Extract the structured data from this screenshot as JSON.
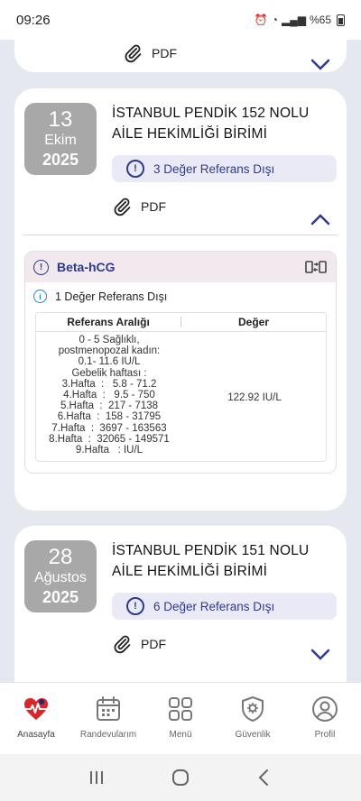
{
  "status_bar": {
    "time": "09:26",
    "battery": "%65"
  },
  "records": [
    {
      "pdf_label": "PDF"
    },
    {
      "date": {
        "day": "13",
        "month": "Ekim",
        "year": "2025"
      },
      "institution": "İSTANBUL PENDİK 152 NOLU AİLE HEKİMLİĞİ BİRİMİ",
      "out_of_range": "3 Değer Referans Dışı",
      "pdf_label": "PDF",
      "test": {
        "name": "Beta-hCG",
        "info": "1 Değer Referans Dışı",
        "columns": [
          "Referans Aralığı",
          "Değer"
        ],
        "reference": "0 - 5 Sağlıklı,\npostmenopozal kadın:\n0.1- 11.6 IU/L\nGebelik haftası :\n3.Hafta  :   5.8 - 71.2\n4.Hafta  :   9.5 - 750\n5.Hafta  :  217 - 7138\n6.Hafta  :  158 - 31795\n7.Hafta  :  3697 - 163563\n8.Hafta  :  32065 - 149571\n9.Hafta   : IU/L",
        "value": "122.92 IU/L"
      }
    },
    {
      "date": {
        "day": "28",
        "month": "Ağustos",
        "year": "2025"
      },
      "institution": "İSTANBUL PENDİK 151 NOLU AİLE HEKİMLİĞİ BİRİMİ",
      "out_of_range": "6 Değer Referans Dışı",
      "pdf_label": "PDF"
    }
  ],
  "bottom_nav": [
    {
      "label": "Anasayfa",
      "icon": "heart-logo-icon"
    },
    {
      "label": "Randevularım",
      "icon": "calendar-icon"
    },
    {
      "label": "Menü",
      "icon": "grid-icon"
    },
    {
      "label": "Güvenlik",
      "icon": "shield-gear-icon"
    },
    {
      "label": "Profil",
      "icon": "user-icon"
    }
  ],
  "colors": {
    "accent": "#2f3a8c",
    "badge": "#a8a8a8",
    "background": "#e6e8ef"
  }
}
